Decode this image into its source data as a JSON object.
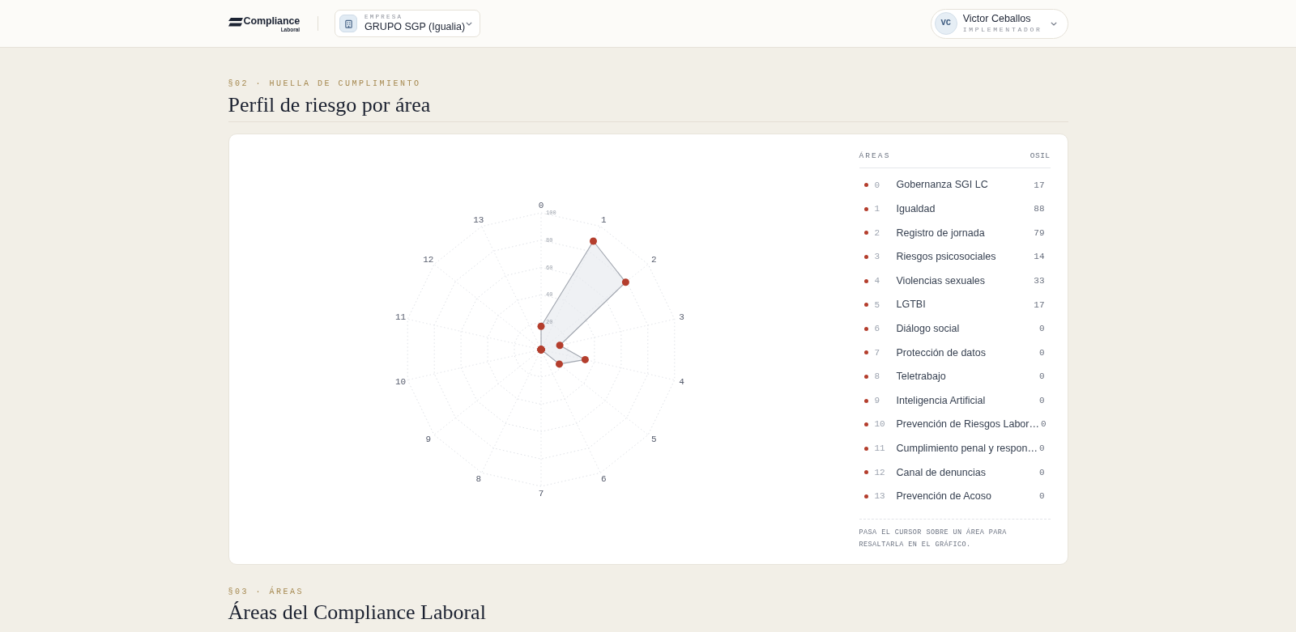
{
  "header": {
    "logo": {
      "name": "Compliance",
      "sub": "Laboral"
    },
    "company": {
      "label": "EMPRESA",
      "value": "GRUPO SGP (Igualia)"
    },
    "user": {
      "initials": "VC",
      "name": "Victor Ceballos",
      "role": "IMPLEMENTADOR"
    }
  },
  "sections": [
    {
      "eyebrow": "§02 · HUELLA DE CUMPLIMIENTO",
      "title": "Perfil de riesgo por área",
      "chart_data": {
        "type": "radar",
        "categories": [
          "0",
          "1",
          "2",
          "3",
          "4",
          "5",
          "6",
          "7",
          "8",
          "9",
          "10",
          "11",
          "12",
          "13"
        ],
        "values": [
          17,
          88,
          79,
          14,
          33,
          17,
          0,
          0,
          0,
          0,
          0,
          0,
          0,
          0
        ],
        "ylim": [
          0,
          100
        ],
        "yticks": [
          20,
          40,
          60,
          80,
          100
        ]
      },
      "legend": {
        "heading": "ÁREAS",
        "value_heading": "OSIL",
        "items": [
          {
            "index": "0",
            "name": "Gobernanza SGI LC",
            "score": "17"
          },
          {
            "index": "1",
            "name": "Igualdad",
            "score": "88"
          },
          {
            "index": "2",
            "name": "Registro de jornada",
            "score": "79"
          },
          {
            "index": "3",
            "name": "Riesgos psicosociales",
            "score": "14"
          },
          {
            "index": "4",
            "name": "Violencias sexuales",
            "score": "33"
          },
          {
            "index": "5",
            "name": "LGTBI",
            "score": "17"
          },
          {
            "index": "6",
            "name": "Diálogo social",
            "score": "0"
          },
          {
            "index": "7",
            "name": "Protección de datos",
            "score": "0"
          },
          {
            "index": "8",
            "name": "Teletrabajo",
            "score": "0"
          },
          {
            "index": "9",
            "name": "Inteligencia Artificial",
            "score": "0"
          },
          {
            "index": "10",
            "name": "Prevención de Riesgos Labor…",
            "score": "0"
          },
          {
            "index": "11",
            "name": "Cumplimiento penal y respon…",
            "score": "0"
          },
          {
            "index": "12",
            "name": "Canal de denuncias",
            "score": "0"
          },
          {
            "index": "13",
            "name": "Prevención de Acoso",
            "score": "0"
          }
        ],
        "hint": "PASA EL CURSOR SOBRE UN ÁREA PARA RESALTARLA EN EL GRÁFICO."
      }
    },
    {
      "eyebrow": "§03 · ÁREAS",
      "title": "Áreas del Compliance Laboral"
    }
  ]
}
